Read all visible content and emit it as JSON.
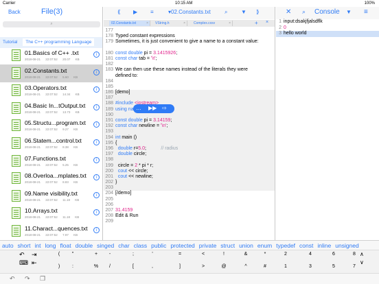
{
  "status": {
    "carrier": "Carrier",
    "time": "10:15 AM",
    "battery": "100%"
  },
  "left": {
    "back": "Back",
    "title": "File(3)",
    "search_icon": "search-icon",
    "crumbs": [
      "Tutorial",
      "The C++ programming Language"
    ],
    "files": [
      {
        "name": "01.Basics of C++ .txt",
        "date": "2018-08-21",
        "time": "22:07:52",
        "size": "20.07 KB"
      },
      {
        "name": "02.Constants.txt",
        "date": "2018-08-21",
        "time": "22:07:52",
        "size": "5.60 KB",
        "selected": true
      },
      {
        "name": "03.Operators.txt",
        "date": "2018-08-21",
        "time": "22:07:52",
        "size": "14.34 KB"
      },
      {
        "name": "04.Basic In...tOutput.txt",
        "date": "2018-08-21",
        "time": "22:07:52",
        "size": "13.73 KB"
      },
      {
        "name": "05.Structu...program.txt",
        "date": "2018-08-21",
        "time": "22:07:52",
        "size": "9.27 KB"
      },
      {
        "name": "06.Statem...control.txt",
        "date": "2018-08-21",
        "time": "22:07:52",
        "size": "8.38 KB"
      },
      {
        "name": "07.Functions.txt",
        "date": "2018-08-21",
        "time": "22:07:52",
        "size": "5.25 KB"
      },
      {
        "name": "08.Overloa...mplates.txt",
        "date": "2018-08-21",
        "time": "22:07:52",
        "size": "8.83 KB"
      },
      {
        "name": "09.Name visibility.txt",
        "date": "2018-08-21",
        "time": "22:07:52",
        "size": "11.18 KB"
      },
      {
        "name": "10.Arrays.txt",
        "date": "2018-08-21",
        "time": "22:07:52",
        "size": "11.18 KB"
      },
      {
        "name": "11.Charact...quences.txt",
        "date": "2018-08-21",
        "time": "22:07:52",
        "size": "7.97 KB"
      }
    ]
  },
  "mid": {
    "toolbar": {
      "prev": "⟪",
      "play": "▶",
      "menu": "≡",
      "file": "▾02.Constants.txt",
      "find": "⌕",
      "down": "▼",
      "next": "⟫"
    },
    "tabs": [
      {
        "label": "02.Constants.txt",
        "active": true
      },
      {
        "label": "VString.h"
      },
      {
        "label": "Complex.cxsv"
      }
    ],
    "tab_add": "+",
    "tab_close": "×",
    "lines": [
      {
        "n": "177",
        "t": "",
        "cls": ""
      },
      {
        "n": "178",
        "t": "Typed constant expressions",
        "cls": ""
      },
      {
        "n": "179",
        "t": "Sometimes, it is just convenient to give a name to a constant value:",
        "cls": ""
      },
      {
        "n": "",
        "t": "",
        "cls": ""
      },
      {
        "n": "180",
        "t": "const double pi = 3.1415926;",
        "cls": "code1"
      },
      {
        "n": "181",
        "t": "const char tab = '\\t';",
        "cls": "code2"
      },
      {
        "n": "182",
        "t": "",
        "cls": ""
      },
      {
        "n": "183",
        "t": "We can then use these names instead of the literals they were",
        "cls": ""
      },
      {
        "n": "",
        "t": "defined to:",
        "cls": ""
      },
      {
        "n": "184",
        "t": "",
        "cls": ""
      },
      {
        "n": "185",
        "t": "",
        "cls": ""
      },
      {
        "n": "186",
        "t": "[demo]",
        "cls": "shade"
      },
      {
        "n": "187",
        "t": "",
        "cls": "shade"
      },
      {
        "n": "188",
        "t": "#include <iostream>",
        "cls": "shade inc"
      },
      {
        "n": "189",
        "t": "using namespace std;",
        "cls": "shade use"
      },
      {
        "n": "190",
        "t": "",
        "cls": "shade"
      },
      {
        "n": "191",
        "t": "const double pi = 3.14159;",
        "cls": "shade code3"
      },
      {
        "n": "192",
        "t": "const char newline = '\\n';",
        "cls": "shade code4"
      },
      {
        "n": "193",
        "t": "",
        "cls": "shade"
      },
      {
        "n": "194",
        "t": "int main ()",
        "cls": "shade main"
      },
      {
        "n": "195",
        "t": "{",
        "cls": "shade"
      },
      {
        "n": "196",
        "t": "  double r=5.0;           // radius",
        "cls": "shade code5"
      },
      {
        "n": "197",
        "t": "  double circle;",
        "cls": "shade code6"
      },
      {
        "n": "198",
        "t": "",
        "cls": "shade"
      },
      {
        "n": "199",
        "t": "  circle = 2 * pi * r;",
        "cls": "shade code7"
      },
      {
        "n": "200",
        "t": "  cout << circle;",
        "cls": "shade code8"
      },
      {
        "n": "201",
        "t": "  cout << newline;",
        "cls": "shade code8"
      },
      {
        "n": "202",
        "t": "}",
        "cls": "shade"
      },
      {
        "n": "203",
        "t": "",
        "cls": "shade"
      },
      {
        "n": "204",
        "t": "[/demo]",
        "cls": ""
      },
      {
        "n": "205",
        "t": "",
        "cls": ""
      },
      {
        "n": "206",
        "t": "",
        "cls": ""
      },
      {
        "n": "207",
        "t": "31.4159",
        "cls": "pink"
      },
      {
        "n": "208",
        "t": "Edit & Run",
        "cls": ""
      },
      {
        "n": "209",
        "t": "",
        "cls": ""
      }
    ]
  },
  "right": {
    "close": "✕",
    "find": "⌕",
    "title": "Console",
    "down": "▼",
    "menu": "≡",
    "lines": [
      {
        "n": "1",
        "t": "input:dsakjfjalsdflk",
        "color": "#000000"
      },
      {
        "n": "2",
        "t": "0",
        "color": "#e0218a"
      },
      {
        "n": "3",
        "t": "hello world",
        "color": "#000000"
      }
    ]
  },
  "keywords": [
    "auto",
    "short",
    "int",
    "long",
    "float",
    "double",
    "singed",
    "char",
    "class",
    "public",
    "protected",
    "private",
    "struct",
    "union",
    "enum",
    "typedef",
    "const",
    "inline",
    "unsigned"
  ],
  "keys_top": [
    "(",
    "\"",
    "+",
    "-",
    ";",
    "'",
    "=",
    "<",
    "!",
    "&",
    "*",
    "2",
    "4",
    "6",
    "8"
  ],
  "keys_bot": [
    ")",
    ":",
    "%",
    "/",
    "[",
    ",",
    "]",
    ">",
    "@",
    "^",
    "#",
    "1",
    "3",
    "5",
    "7"
  ],
  "bottom": {
    "undo": "↶",
    "redo": "↷",
    "copy": "❐"
  }
}
